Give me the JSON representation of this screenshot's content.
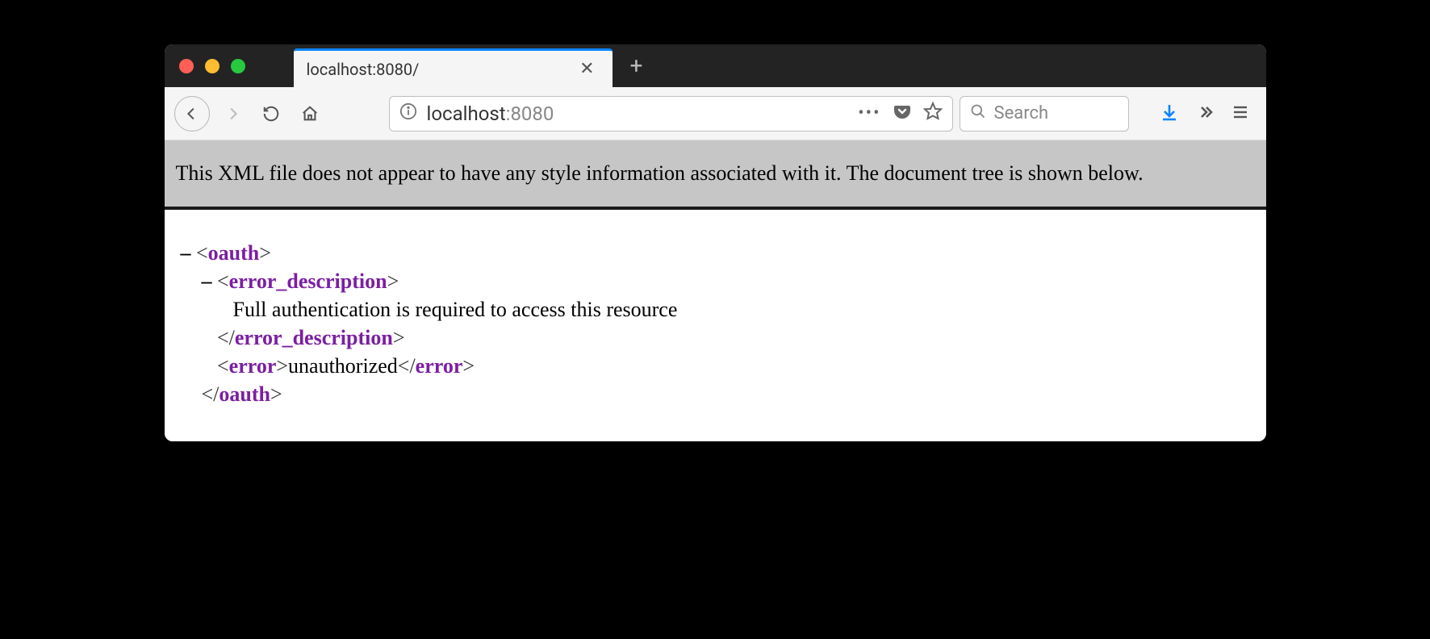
{
  "tab": {
    "title": "localhost:8080/"
  },
  "url": {
    "host": "localhost",
    "port": ":8080"
  },
  "search": {
    "placeholder": "Search"
  },
  "message": "This XML file does not appear to have any style information associated with it. The document tree is shown below.",
  "xml": {
    "root_tag": "oauth",
    "desc_tag": "error_description",
    "desc_text": "Full authentication is required to access this resource",
    "error_tag": "error",
    "error_text": "unauthorized"
  }
}
